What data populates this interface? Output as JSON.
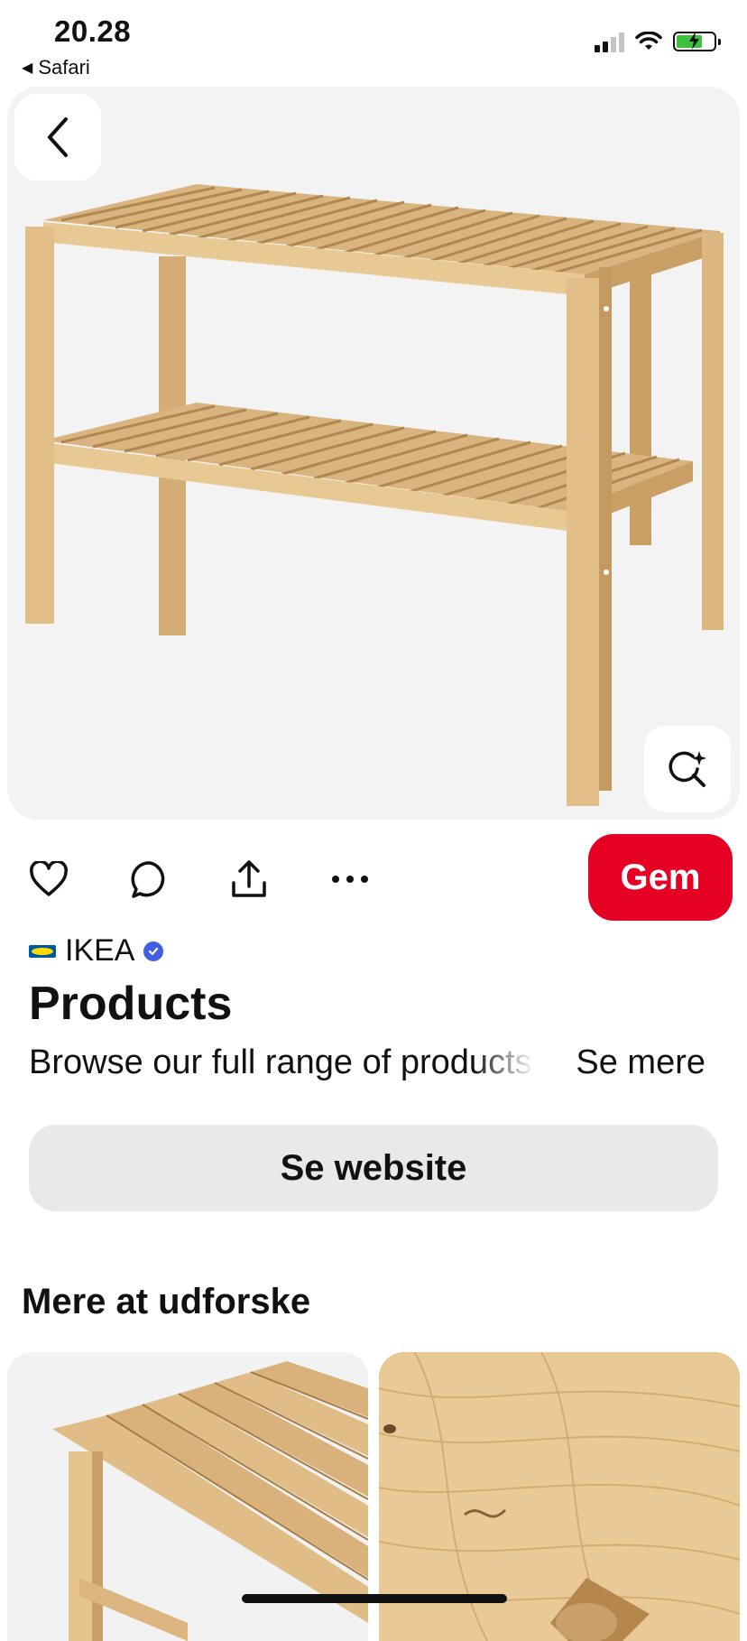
{
  "status_bar": {
    "time": "20.28",
    "back_app": "Safari",
    "icons": [
      "signal-icon",
      "wifi-icon",
      "battery-charging-icon"
    ]
  },
  "hero": {
    "image": "wooden-slatted-bench",
    "back_icon": "chevron-left-icon",
    "visual_search_icon": "lens-sparkle-icon"
  },
  "actions": {
    "icons": [
      "heart-icon",
      "comment-icon",
      "share-icon",
      "more-icon"
    ],
    "save_label": "Gem",
    "save_color": "#e60023"
  },
  "pin": {
    "brand": "IKEA",
    "verified": true,
    "title": "Products",
    "description": "Browse our full range of products",
    "see_more": "Se mere",
    "website_button": "Se website"
  },
  "explore": {
    "title": "Mere at udforske",
    "items": [
      {
        "image": "bench-slats-closeup"
      },
      {
        "image": "pine-wood-closeup"
      }
    ]
  }
}
